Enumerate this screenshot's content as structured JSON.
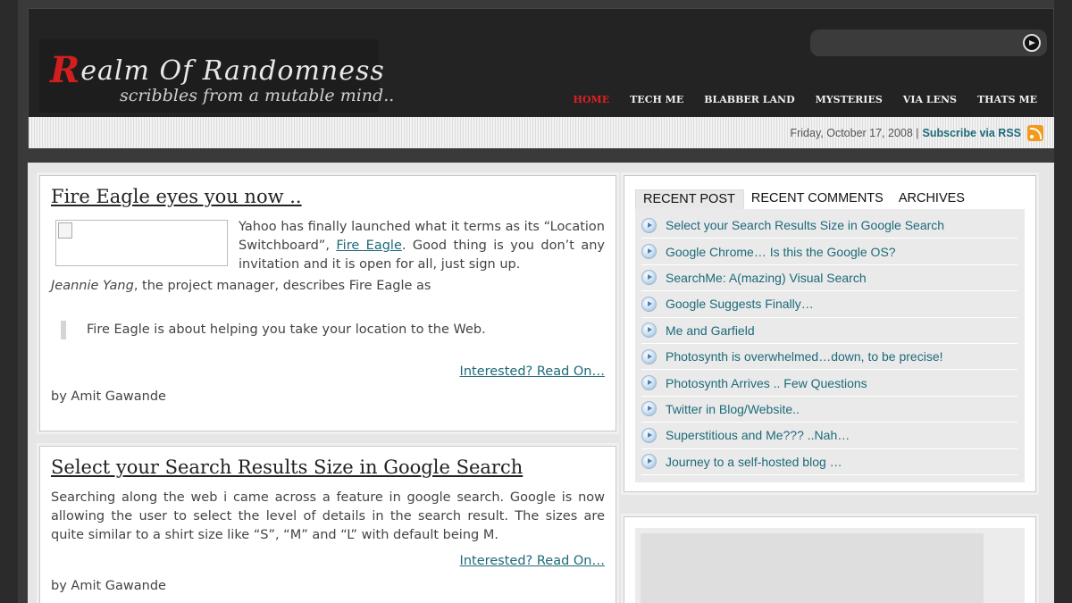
{
  "header": {
    "logo_initial": "R",
    "logo_rest": "ealm Of Randomness",
    "tagline": "scribbles from a mutable mind..",
    "search": {
      "value": "",
      "placeholder": ""
    },
    "nav": [
      "HOME",
      "TECH ME",
      "BLABBER LAND",
      "MYSTERIES",
      "VIA LENS",
      "THATS ME"
    ],
    "active_nav": "HOME"
  },
  "datebar": {
    "date": "Friday, October 17, 2008 |",
    "subscribe": "Subscribe via RSS",
    "icon": "rss-icon"
  },
  "posts": [
    {
      "title": "Fire Eagle eyes you now ..",
      "intro_before": "Yahoo has finally launched what it terms as its “Location Switchboard”, ",
      "intro_link": "Fire Eagle",
      "intro_after": ". Good thing is you don’t any invitation and it is open for all, just sign up.",
      "person": "Jeannie Yang",
      "person_rest": ", the project manager, describes Fire Eagle as",
      "quote": "Fire Eagle is about helping you take your location to the Web.",
      "read_on": "Interested? Read On…",
      "byline": "by Amit Gawande"
    },
    {
      "title": "Select your Search Results Size in Google Search",
      "body": "Searching along the web i came across a feature in google search. Google is now allowing the user to select the level of details in the search result. The sizes are quite similar to a shirt size like “S”, “M” and “L” with default being M.",
      "read_on": "Interested? Read On…",
      "byline": "by Amit Gawande"
    }
  ],
  "sidebar": {
    "tabs": [
      "RECENT POST",
      "RECENT COMMENTS",
      "ARCHIVES"
    ],
    "active_tab": "RECENT POST",
    "recent_posts": [
      "Select your Search Results Size in Google Search",
      "Google Chrome… Is this the Google OS?",
      "SearchMe: A(mazing) Visual Search",
      "Google Suggests Finally…",
      "Me and Garfield",
      "Photosynth is overwhelmed…down, to be precise!",
      "Photosynth Arrives .. Few Questions",
      "Twitter in Blog/Website..",
      "Superstitious and Me??? ..Nah…",
      "Journey to a self-hosted blog …"
    ]
  },
  "colors": {
    "accent_link": "#1d6a7a",
    "nav_active": "#e02020",
    "header_bg": "#232323",
    "rss": "#f29a1d"
  }
}
